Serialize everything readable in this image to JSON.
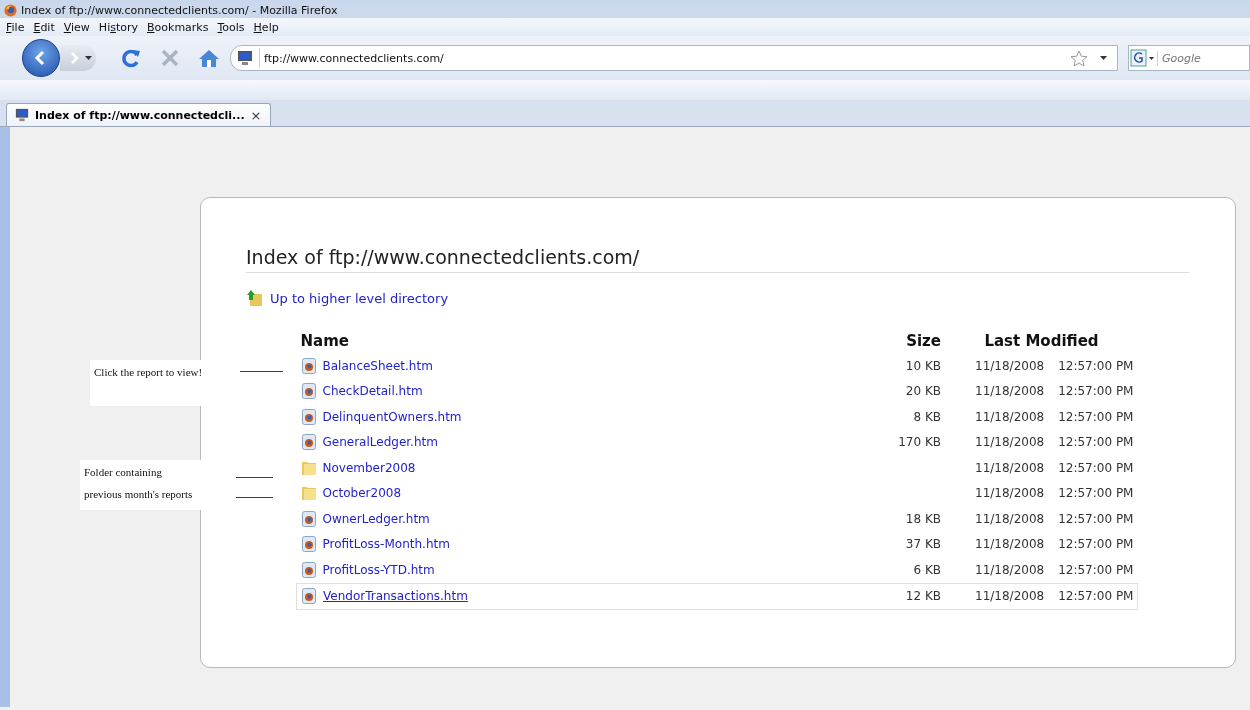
{
  "window": {
    "title": "Index of ftp://www.connectedclients.com/ - Mozilla Firefox"
  },
  "menu": [
    {
      "key": "F",
      "after": "ile"
    },
    {
      "key": "E",
      "after": "dit"
    },
    {
      "key": "V",
      "after": "iew"
    },
    {
      "before": "Hi",
      "key": "s",
      "after": "tory"
    },
    {
      "key": "B",
      "after": "ookmarks"
    },
    {
      "key": "T",
      "after": "ools"
    },
    {
      "key": "H",
      "after": "elp"
    }
  ],
  "address": {
    "value": "ftp://www.connectedclients.com/"
  },
  "search": {
    "placeholder": "Google"
  },
  "tabs": [
    {
      "label": "Index of ftp://www.connectedcli...",
      "close": "×",
      "selected": true
    }
  ],
  "page": {
    "heading": "Index of ftp://www.connectedclients.com/",
    "up_link": "Up to higher level directory",
    "columns": [
      "Name",
      "Size",
      "Last Modified"
    ],
    "rows": [
      {
        "kind": "file",
        "name": "BalanceSheet.htm",
        "size": "10 KB",
        "date": "11/18/2008",
        "time": "12:57:00 PM",
        "hovered": false
      },
      {
        "kind": "file",
        "name": "CheckDetail.htm",
        "size": "20 KB",
        "date": "11/18/2008",
        "time": "12:57:00 PM",
        "hovered": false
      },
      {
        "kind": "file",
        "name": "DelinquentOwners.htm",
        "size": "8 KB",
        "date": "11/18/2008",
        "time": "12:57:00 PM",
        "hovered": false
      },
      {
        "kind": "file",
        "name": "GeneralLedger.htm",
        "size": "170 KB",
        "date": "11/18/2008",
        "time": "12:57:00 PM",
        "hovered": false
      },
      {
        "kind": "folder",
        "name": "November2008",
        "date": "11/18/2008",
        "time": "12:57:00 PM",
        "hovered": false
      },
      {
        "kind": "folder",
        "name": "October2008",
        "date": "11/18/2008",
        "time": "12:57:00 PM",
        "hovered": false
      },
      {
        "kind": "file",
        "name": "OwnerLedger.htm",
        "size": "18 KB",
        "date": "11/18/2008",
        "time": "12:57:00 PM",
        "hovered": false
      },
      {
        "kind": "file",
        "name": "ProfitLoss-Month.htm",
        "size": "37 KB",
        "date": "11/18/2008",
        "time": "12:57:00 PM",
        "hovered": false
      },
      {
        "kind": "file",
        "name": "ProfitLoss-YTD.htm",
        "size": "6 KB",
        "date": "11/18/2008",
        "time": "12:57:00 PM",
        "hovered": false
      },
      {
        "kind": "file",
        "name": "VendorTransactions.htm",
        "size": "12 KB",
        "date": "11/18/2008",
        "time": "12:57:00 PM",
        "hovered": true
      }
    ]
  },
  "annotations": [
    {
      "lines": [
        "Click the report to view!"
      ]
    },
    {
      "lines": [
        "Folder containing",
        "previous month's reports"
      ]
    }
  ]
}
